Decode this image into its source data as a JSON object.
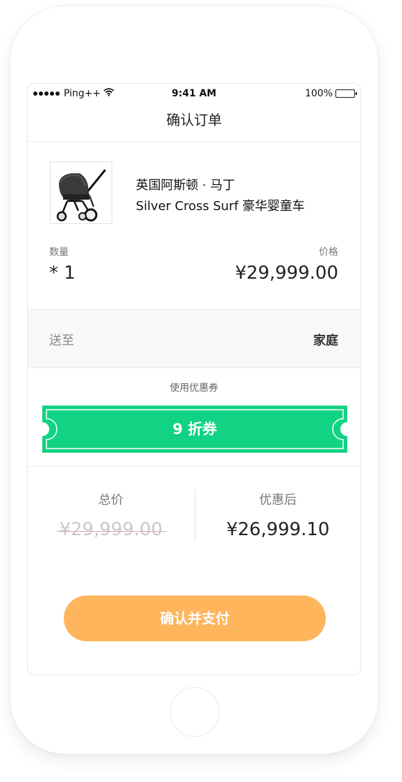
{
  "status_bar": {
    "carrier": "Ping++",
    "time": "9:41 AM",
    "battery": "100%"
  },
  "nav": {
    "title": "确认订单"
  },
  "product": {
    "image_icon": "baby-stroller-image",
    "name": "英国阿斯顿 · 马丁",
    "subtitle": "Silver Cross Surf 豪华婴童车",
    "quantity_label": "数量",
    "quantity_value": "* 1",
    "price_label": "价格",
    "price_value": "¥29,999.00"
  },
  "shipping": {
    "label": "送至",
    "value": "家庭"
  },
  "coupon": {
    "section_title": "使用优惠券",
    "label": "9 折券",
    "color": "#12d384"
  },
  "totals": {
    "original_label": "总价",
    "original_value": "¥29,999.00",
    "discounted_label": "优惠后",
    "discounted_value": "¥26,999.10"
  },
  "actions": {
    "pay_label": "确认并支付",
    "pay_color": "#ffb55c"
  }
}
